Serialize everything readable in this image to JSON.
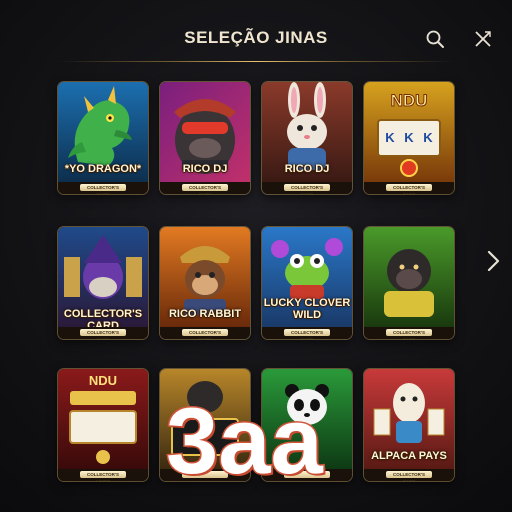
{
  "header": {
    "title": "SELEÇÃO JINAS",
    "search_icon": "search-icon",
    "close_icon": "close-icon"
  },
  "navigation": {
    "next_icon": "chevron-right-icon"
  },
  "games": [
    {
      "name": "*YO DRAGON*",
      "plate": "COLLECTOR'S CARD"
    },
    {
      "name": "RICO DJ",
      "plate": "COLLECTOR'S CARD"
    },
    {
      "name": "RICO DJ",
      "plate": "COLLECTOR'S CARD"
    },
    {
      "name": "",
      "plate": "COLLECTOR'S CARD"
    },
    {
      "name": "COLLECTOR'S CARD",
      "plate": "COLLECTOR'S CARD"
    },
    {
      "name": "RICO RABBIT",
      "plate": "COLLECTOR'S CARD"
    },
    {
      "name": "LUCKY CLOVER WILD",
      "plate": "COLLECTOR'S CARD"
    },
    {
      "name": "",
      "plate": "COLLECTOR'S CARD"
    },
    {
      "name": "",
      "plate": "COLLECTOR'S LIMBO"
    },
    {
      "name": "",
      "plate": ""
    },
    {
      "name": "",
      "plate": ""
    },
    {
      "name": "ALPACA PAYS",
      "plate": "COLLECTOR'S CARD"
    }
  ],
  "overlay": {
    "text": "3aa"
  },
  "colors": {
    "accent_gold": "#d9a84a",
    "overlay_stroke": "#d2553a",
    "background": "#121215"
  }
}
